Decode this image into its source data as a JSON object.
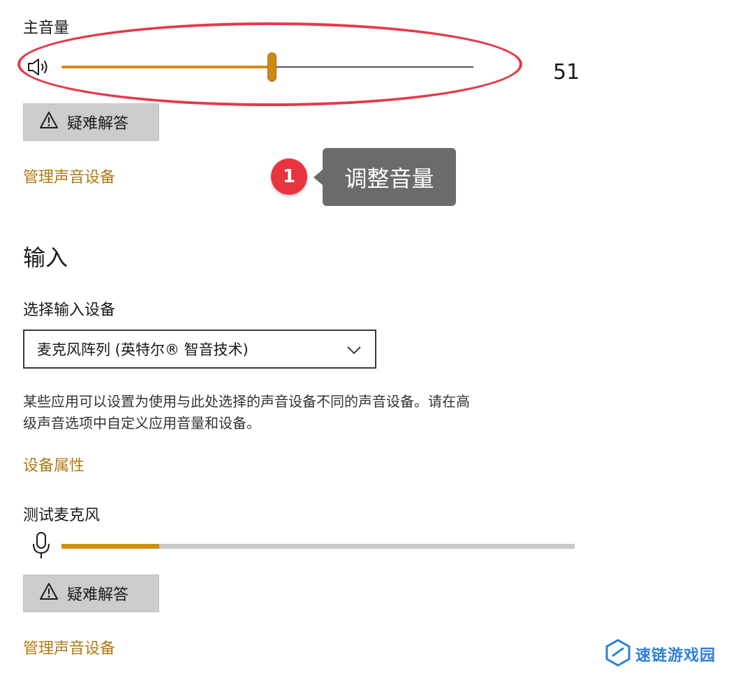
{
  "output": {
    "master_volume_label": "主音量",
    "volume_value": "51",
    "volume_level": 0.51,
    "troubleshoot_label": "疑难解答",
    "manage_devices_link": "管理声音设备"
  },
  "annotation": {
    "badge_number": "1",
    "callout_text": "调整音量",
    "highlight_color": "#e43a4a"
  },
  "input": {
    "heading": "输入",
    "select_device_label": "选择输入设备",
    "selected_device": "麦克风阵列 (英特尔® 智音技术)",
    "description_line1": "某些应用可以设置为使用与此处选择的声音设备不同的声音设备。请在高",
    "description_line2": "级声音选项中自定义应用音量和设备。",
    "device_properties_link": "设备属性",
    "test_mic_label": "测试麦克风",
    "mic_level": 0.19,
    "troubleshoot_label": "疑难解答",
    "manage_devices_link": "管理声音设备"
  },
  "watermark": {
    "text": "速链游戏园"
  },
  "icons": {
    "speaker": "speaker-icon",
    "warning": "warning-icon",
    "chevron": "chevron-down-icon",
    "microphone": "microphone-icon"
  },
  "colors": {
    "accent": "#d08f14",
    "link": "#b07a12",
    "badge": "#e8343f"
  }
}
